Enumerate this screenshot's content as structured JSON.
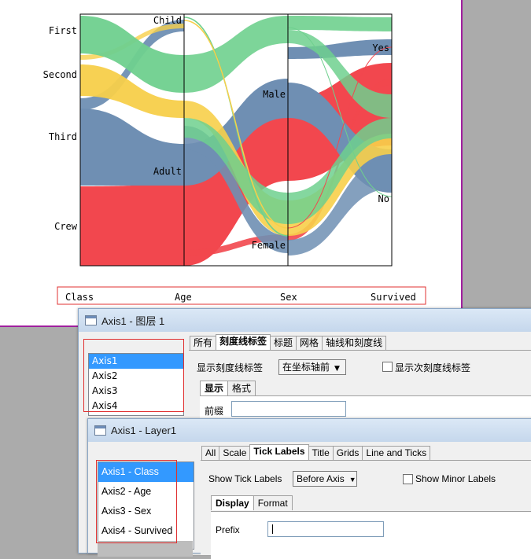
{
  "chart": {
    "axis_names": [
      "Class",
      "Age",
      "Sex",
      "Survived"
    ],
    "class_levels": [
      "First",
      "Second",
      "Third",
      "Crew"
    ],
    "age_levels": [
      "Child",
      "Adult"
    ],
    "sex_levels": [
      "Male",
      "Female"
    ],
    "survived_levels": [
      "Yes",
      "No"
    ]
  },
  "chart_data": {
    "type": "parallel-sets",
    "axes": [
      "Class",
      "Age",
      "Sex",
      "Survived"
    ],
    "levels": {
      "Class": [
        "First",
        "Second",
        "Third",
        "Crew"
      ],
      "Age": [
        "Child",
        "Adult"
      ],
      "Sex": [
        "Male",
        "Female"
      ],
      "Survived": [
        "Yes",
        "No"
      ]
    },
    "colors": {
      "First": "#6fd08e",
      "Second": "#f7cf4a",
      "Third": "#6f8fb3",
      "Crew": "#f2474e"
    }
  },
  "dialog_cn": {
    "title": "Axis1 - 图层 1",
    "list_items": [
      "Axis1",
      "Axis2",
      "Axis3",
      "Axis4"
    ],
    "tabs": [
      "所有",
      "刻度线标签",
      "标题",
      "网格",
      "轴线和刻度线"
    ],
    "show_tick_labels_label": "显示刻度线标签",
    "show_tick_labels_value": "在坐标轴前",
    "show_minor_labels": "显示次刻度线标签",
    "subtabs": [
      "显示",
      "格式"
    ],
    "prefix_label": "前缀"
  },
  "dialog_en": {
    "title": "Axis1 - Layer1",
    "list_items": [
      "Axis1 - Class",
      "Axis2 - Age",
      "Axis3 - Sex",
      "Axis4 - Survived"
    ],
    "tabs": [
      "All",
      "Scale",
      "Tick Labels",
      "Title",
      "Grids",
      "Line and Ticks"
    ],
    "show_tick_labels_label": "Show Tick Labels",
    "show_tick_labels_value": "Before Axis",
    "show_minor_labels": "Show Minor Labels",
    "subtabs": [
      "Display",
      "Format"
    ],
    "prefix_label": "Prefix",
    "prefix_value": ""
  }
}
